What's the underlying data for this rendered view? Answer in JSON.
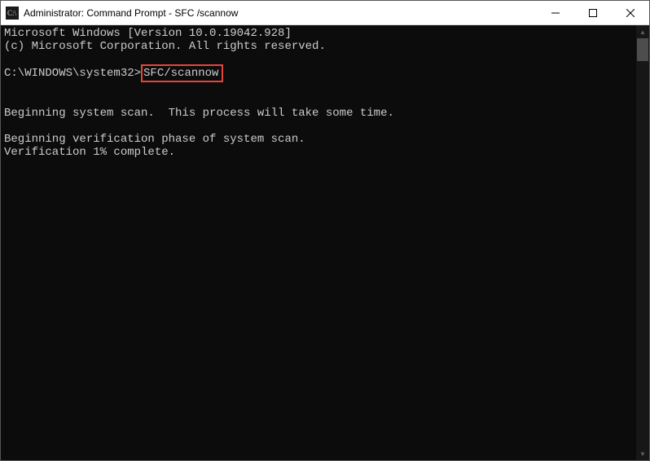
{
  "titlebar": {
    "title": "Administrator: Command Prompt - SFC /scannow"
  },
  "console": {
    "line1": "Microsoft Windows [Version 10.0.19042.928]",
    "line2": "(c) Microsoft Corporation. All rights reserved.",
    "blank": "",
    "prompt_prefix": "C:\\WINDOWS\\system32>",
    "command": "SFC/scannow",
    "line4": "Beginning system scan.  This process will take some time.",
    "line5": "Beginning verification phase of system scan.",
    "line6": "Verification 1% complete."
  }
}
